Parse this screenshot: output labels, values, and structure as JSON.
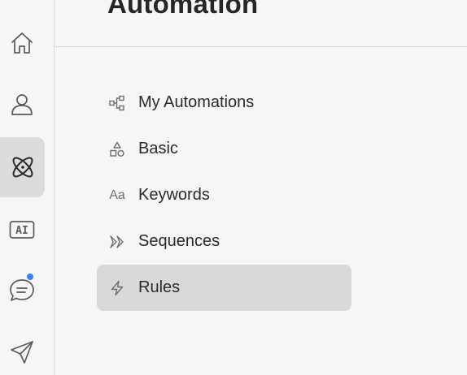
{
  "header": {
    "title": "Automation"
  },
  "rail": {
    "items": [
      {
        "icon": "home-icon"
      },
      {
        "icon": "user-icon"
      },
      {
        "icon": "atom-icon",
        "active": true
      },
      {
        "icon": "ai-icon",
        "text": "AI"
      },
      {
        "icon": "chat-icon",
        "badge": true
      },
      {
        "icon": "send-icon"
      }
    ],
    "badge_color": "#3b82f6",
    "active_bg": "#dcdcdc"
  },
  "menu": {
    "items": [
      {
        "label": "My Automations",
        "icon": "flow-icon"
      },
      {
        "label": "Basic",
        "icon": "shapes-icon"
      },
      {
        "label": "Keywords",
        "icon": "text-aa-icon",
        "icon_text": "Aa"
      },
      {
        "label": "Sequences",
        "icon": "double-chevron-icon"
      },
      {
        "label": "Rules",
        "icon": "lightning-icon",
        "selected": true
      }
    ],
    "selected_bg": "#d9d9d9"
  }
}
